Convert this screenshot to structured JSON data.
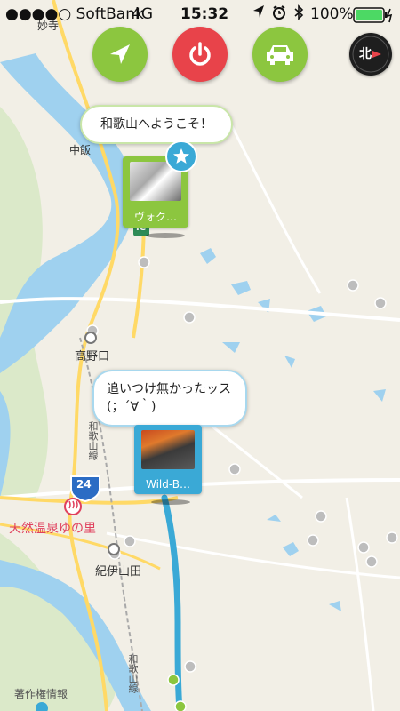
{
  "status_bar": {
    "carrier": "●●●●○ SoftBank",
    "network": "4G",
    "time": "15:32",
    "battery": "100%"
  },
  "controls": {
    "navigate_icon": "arrow-location-icon",
    "power_icon": "power-icon",
    "car_icon": "car-icon",
    "compass_label": "北"
  },
  "pins": [
    {
      "bubble_text": "和歌山へようこそ！",
      "caption": "ヴォク…",
      "color": "#8cc63f",
      "favorite": true
    },
    {
      "bubble_text": "追いつけ無かったッス (；´∀｀)",
      "caption": "Wild-B…",
      "color": "#3aa9d6",
      "favorite": false
    }
  ],
  "map_labels": {
    "top_partial": "妙寺",
    "middle_partial": "中飯",
    "koyaguchi": "高野口",
    "hot_spring": "天然温泉ゆの里",
    "kii_yamada": "紀伊山田",
    "line_name": "和歌山線",
    "line_name_bottom": "和歌山線",
    "route_number": "24",
    "ic_label": "IC",
    "attribution": "著作権情報"
  },
  "colors": {
    "green_button": "#8cc63f",
    "red_button": "#e8434a",
    "route": "#3aa9d6",
    "river": "#9fd1ef",
    "road": "#ffd966"
  }
}
